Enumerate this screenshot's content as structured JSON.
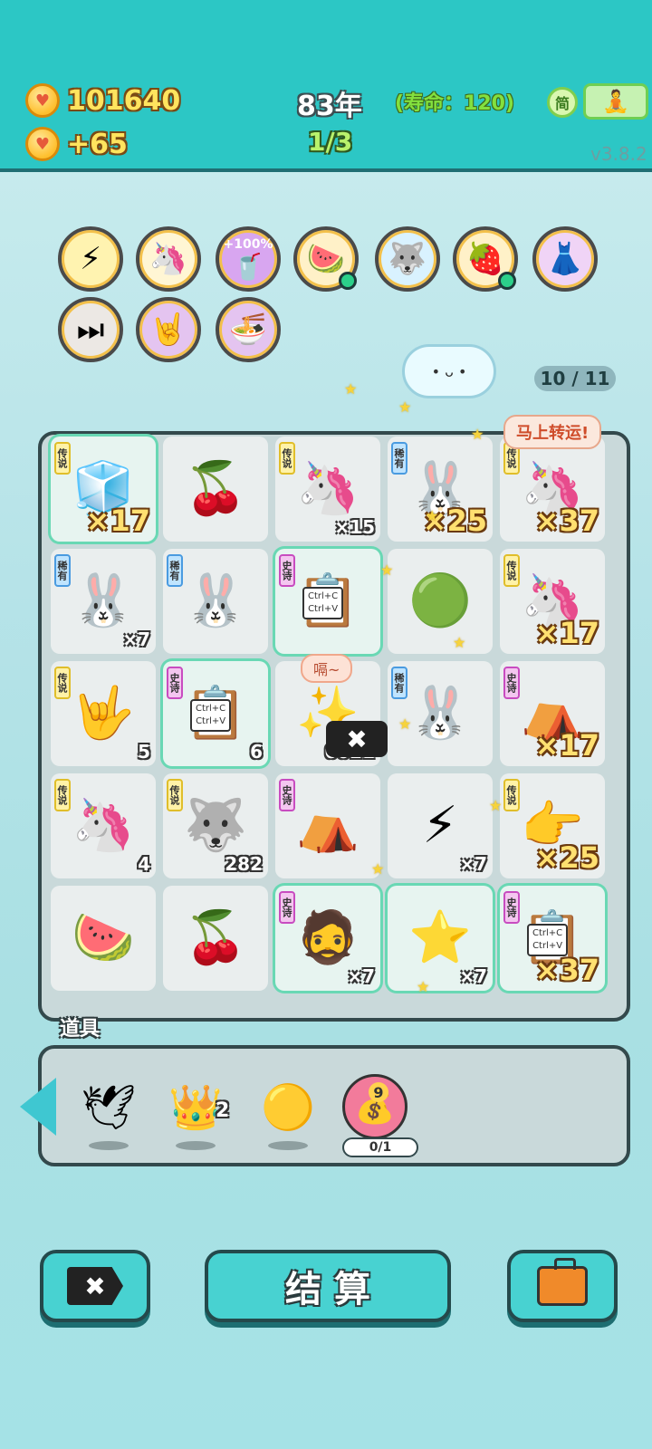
{
  "header": {
    "coins": "101640",
    "coin_gain": "+65",
    "year": "83年",
    "lifespan": "(寿命：120)",
    "round": "1/3",
    "simplified_label": "简",
    "version": "v3.8.2"
  },
  "buffs": {
    "counter": "10 / 11",
    "bonus_label": "+100%"
  },
  "board": {
    "speech_lucky": "马上转运!",
    "speech_hiccup": "嗝~",
    "tiles": [
      {
        "tag": "传说",
        "art": "🧊",
        "mult": "×17"
      },
      {
        "tag": "",
        "art": "🍒",
        "mult": ""
      },
      {
        "tag": "传说",
        "art": "🦄",
        "mult": "×15"
      },
      {
        "tag": "稀有",
        "art": "🐰",
        "mult": "×25"
      },
      {
        "tag": "传说",
        "art": "🦄",
        "mult": "×37"
      },
      {
        "tag": "稀有",
        "art": "🐰",
        "mult": "×7"
      },
      {
        "tag": "稀有",
        "art": "🐰",
        "mult": ""
      },
      {
        "tag": "史诗",
        "art": "📋",
        "mult": ""
      },
      {
        "tag": "",
        "art": "🟢",
        "mult": ""
      },
      {
        "tag": "传说",
        "art": "🦄",
        "mult": "×17"
      },
      {
        "tag": "传说",
        "art": "🤟",
        "mult": "5"
      },
      {
        "tag": "史诗",
        "art": "📋",
        "mult": "6"
      },
      {
        "tag": "",
        "art": "✨",
        "mult": "6021"
      },
      {
        "tag": "稀有",
        "art": "🐰",
        "mult": ""
      },
      {
        "tag": "史诗",
        "art": "⛺",
        "mult": "×17"
      },
      {
        "tag": "传说",
        "art": "🦄",
        "mult": "4"
      },
      {
        "tag": "传说",
        "art": "🐺",
        "mult": "282"
      },
      {
        "tag": "史诗",
        "art": "⛺",
        "mult": ""
      },
      {
        "tag": "",
        "art": "⚡",
        "mult": "×7"
      },
      {
        "tag": "传说",
        "art": "👉",
        "mult": "×25"
      },
      {
        "tag": "",
        "art": "🍉",
        "mult": ""
      },
      {
        "tag": "",
        "art": "🍒",
        "mult": ""
      },
      {
        "tag": "史诗",
        "art": "🧔",
        "mult": "×7"
      },
      {
        "tag": "",
        "art": "⭐",
        "mult": "×7"
      },
      {
        "tag": "史诗",
        "art": "📋",
        "mult": "×37"
      }
    ],
    "ctrl_c": "Ctrl+C",
    "ctrl_v": "Ctrl+V"
  },
  "items": {
    "label": "道具",
    "crown_count": "2",
    "coin_bag_number": "9",
    "progress": "0/1"
  },
  "actions": {
    "settle_label": "结 算"
  }
}
